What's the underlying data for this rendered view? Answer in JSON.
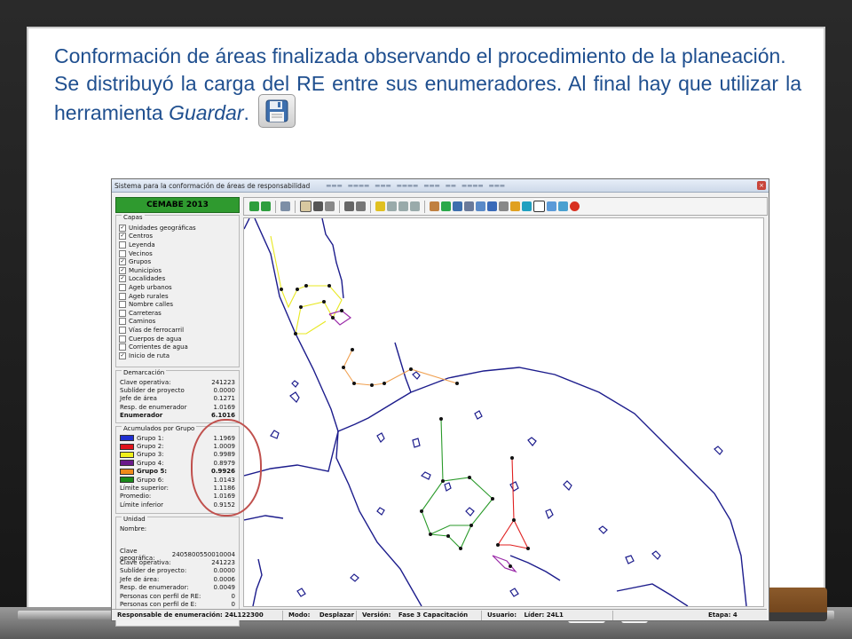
{
  "slide": {
    "paragraph1": "Conformación de áreas finalizada observando el procedimiento de la planeación.",
    "paragraph2_pre": "Se distribuyó la carga del RE entre sus enumeradores. Al final hay que utilizar la herramienta ",
    "paragraph2_em": "Guardar",
    "paragraph2_post": ".",
    "save_icon": "floppy-disk-icon"
  },
  "app": {
    "title": "Sistema para la conformación de áreas de responsabilidad",
    "banner": "CEMABE 2013",
    "capas": {
      "title": "Capas",
      "items": [
        {
          "label": "Unidades geográficas",
          "checked": true
        },
        {
          "label": "Centros",
          "checked": true
        },
        {
          "label": "Leyenda",
          "checked": false
        },
        {
          "label": "Vecinos",
          "checked": false
        },
        {
          "label": "Grupos",
          "checked": true
        },
        {
          "label": "Municipios",
          "checked": true
        },
        {
          "label": "Localidades",
          "checked": true
        },
        {
          "label": "Ageb urbanos",
          "checked": false
        },
        {
          "label": "Ageb rurales",
          "checked": false
        },
        {
          "label": "Nombre calles",
          "checked": false
        },
        {
          "label": "Carreteras",
          "checked": false
        },
        {
          "label": "Caminos",
          "checked": false
        },
        {
          "label": "Vías de ferrocarril",
          "checked": false
        },
        {
          "label": "Cuerpos de agua",
          "checked": false
        },
        {
          "label": "Corrientes de agua",
          "checked": false
        },
        {
          "label": "Inicio de ruta",
          "checked": true
        }
      ]
    },
    "demarcacion": {
      "title": "Demarcación",
      "rows": [
        {
          "label": "Clave operativa:",
          "value": "241223",
          "bold": false
        },
        {
          "label": "Sublíder de proyecto",
          "value": "0.0000",
          "bold": false
        },
        {
          "label": "Jefe de área",
          "value": "0.1271",
          "bold": false
        },
        {
          "label": "Resp. de enumerador",
          "value": "1.0169",
          "bold": false
        },
        {
          "label": "Enumerador",
          "value": "6.1016",
          "bold": true
        }
      ]
    },
    "acumulados": {
      "title": "Acumulados por Grupo",
      "groups": [
        {
          "label": "Grupo 1:",
          "value": "1.1969",
          "color": "#1f2fd0",
          "bold": false
        },
        {
          "label": "Grupo 2:",
          "value": "1.0009",
          "color": "#e0141c",
          "bold": false
        },
        {
          "label": "Grupo 3:",
          "value": "0.9989",
          "color": "#f0f01a",
          "bold": false
        },
        {
          "label": "Grupo 4:",
          "value": "0.8979",
          "color": "#6a1a8a",
          "bold": false
        },
        {
          "label": "Grupo 5:",
          "value": "0.9926",
          "color": "#f08a1a",
          "bold": true
        },
        {
          "label": "Grupo 6:",
          "value": "1.0143",
          "color": "#1a8a1a",
          "bold": false
        }
      ],
      "limits": [
        {
          "label": "Límite superior:",
          "value": "1.1186"
        },
        {
          "label": "Promedio:",
          "value": "1.0169"
        },
        {
          "label": "Límite inferior",
          "value": "0.9152"
        }
      ]
    },
    "unidad": {
      "title": "Unidad",
      "nombre_label": "Nombre:",
      "rows": [
        {
          "label": "Clave geográfica:",
          "value": "2405800550010004"
        },
        {
          "label": "Clave operativa:",
          "value": "241223"
        },
        {
          "label": "Sublíder de proyecto:",
          "value": "0.0000"
        },
        {
          "label": "Jefe de área:",
          "value": "0.0006"
        },
        {
          "label": "Resp. de enumerador:",
          "value": "0.0049"
        },
        {
          "label": "Personas con perfil de RE:",
          "value": "0"
        },
        {
          "label": "Personas con perfil de E:",
          "value": "0"
        }
      ]
    },
    "status": {
      "responsable": "Responsable de enumeración: 24L122300",
      "modo_label": "Modo:",
      "modo_value": "Desplazar",
      "version_label": "Versión:",
      "version_value": "Fase 3 Capacitación",
      "usuario_label": "Usuario:",
      "usuario_value": "Líder: 24L1",
      "etapa": "Etapa: 4"
    }
  }
}
